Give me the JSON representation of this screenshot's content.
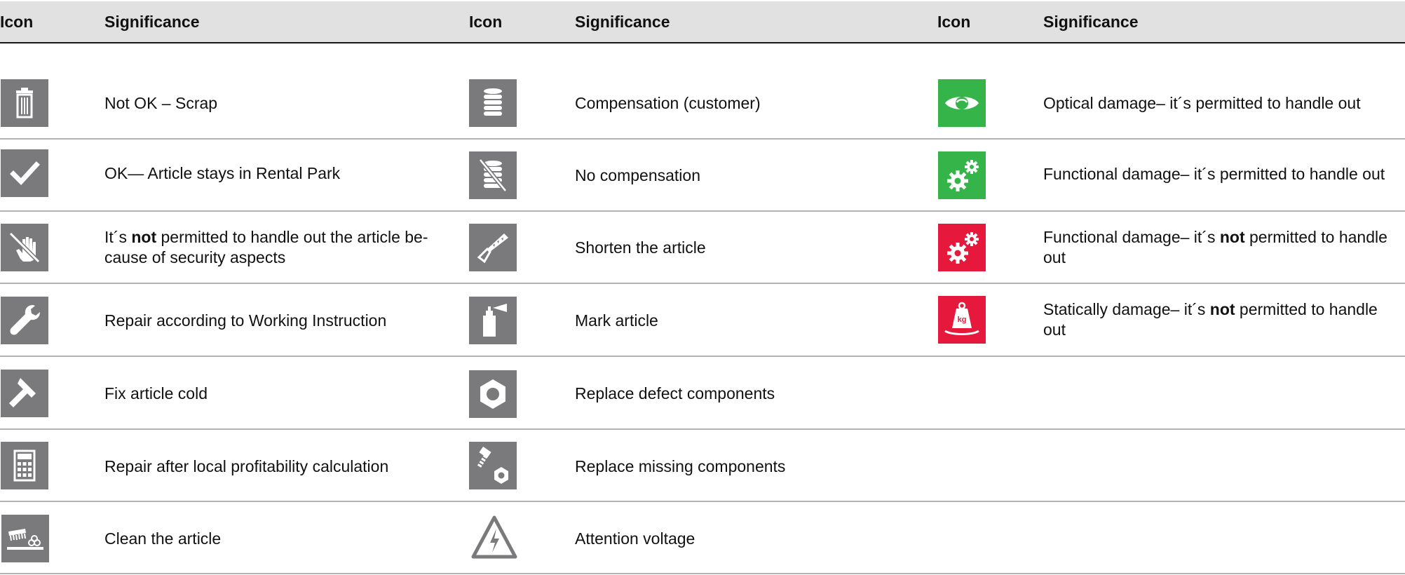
{
  "header": {
    "columns": [
      {
        "icon_label": "Icon",
        "significance_label": "Significance"
      },
      {
        "icon_label": "Icon",
        "significance_label": "Significance"
      },
      {
        "icon_label": "Icon",
        "significance_label": "Significance"
      }
    ]
  },
  "table": {
    "col1": [
      {
        "icon": "trash-can-icon",
        "pre": "Not OK – Scrap",
        "bold": "",
        "post": ""
      },
      {
        "icon": "checkmark-icon",
        "pre": "OK— Article stays in Rental Park",
        "bold": "",
        "post": ""
      },
      {
        "icon": "no-hand-icon",
        "pre": "It´s ",
        "bold": "not",
        "post": " permitted to handle out the article be-cause of security aspects"
      },
      {
        "icon": "wrench-icon",
        "pre": "Repair according to Working Instruction",
        "bold": "",
        "post": ""
      },
      {
        "icon": "hammer-icon",
        "pre": "Fix article cold",
        "bold": "",
        "post": ""
      },
      {
        "icon": "calculator-icon",
        "pre": "Repair after local profitability calculation",
        "bold": "",
        "post": ""
      },
      {
        "icon": "cleaning-brush-icon",
        "pre": "Clean the article",
        "bold": "",
        "post": ""
      }
    ],
    "col2": [
      {
        "icon": "coin-stack-icon",
        "pre": "Compensation (customer)",
        "bold": "",
        "post": ""
      },
      {
        "icon": "no-coins-icon",
        "pre": "No compensation",
        "bold": "",
        "post": ""
      },
      {
        "icon": "saw-icon",
        "pre": "Shorten the article",
        "bold": "",
        "post": ""
      },
      {
        "icon": "spray-can-icon",
        "pre": "Mark article",
        "bold": "",
        "post": ""
      },
      {
        "icon": "hex-nut-icon",
        "pre": "Replace defect components",
        "bold": "",
        "post": ""
      },
      {
        "icon": "bolt-and-nut-icon",
        "pre": "Replace missing components",
        "bold": "",
        "post": ""
      },
      {
        "icon": "voltage-warning-icon",
        "pre": "Attention voltage",
        "bold": "",
        "post": ""
      }
    ],
    "col3": [
      {
        "icon": "eye-icon",
        "pre": "Optical damage– it´s permitted to handle out",
        "bold": "",
        "post": ""
      },
      {
        "icon": "gears-icon",
        "pre": "Functional damage– it´s permitted to handle out",
        "bold": "",
        "post": ""
      },
      {
        "icon": "gears-icon",
        "pre": "Functional damage– it´s  ",
        "bold": "not",
        "post": " permitted to handle out"
      },
      {
        "icon": "kg-weight-icon",
        "pre": "Statically damage– it´s ",
        "bold": "not",
        "post": " permitted to handle out"
      }
    ]
  },
  "colors": {
    "icon_gray": "#7a7a7c",
    "icon_green": "#35b44a",
    "icon_red": "#e6193c",
    "header_bg": "#e1e1e1"
  }
}
